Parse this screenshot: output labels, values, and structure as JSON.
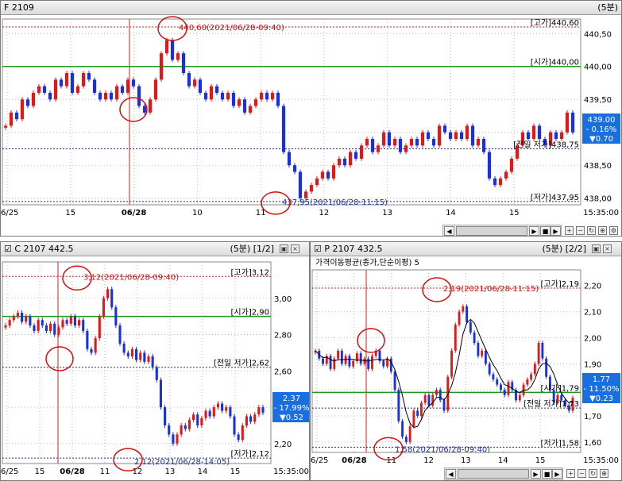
{
  "panels": {
    "top": {
      "title": "F 2109",
      "interval": "(5분)",
      "current_box": {
        "price": "439.00",
        "pct": "- 0.16%",
        "chg": "▼0.70"
      },
      "time_label": "15:35:00"
    },
    "left": {
      "title": "C 2107 442.5",
      "interval": "(5분)",
      "page": "[1/2]",
      "current_box": {
        "price": "2.37",
        "pct": "- 17.99%",
        "chg": "▼0.52"
      },
      "time_label": "15:35:00"
    },
    "right": {
      "title": "P 2107 432.5",
      "interval": "(5분)",
      "page": "[2/2]",
      "indicator": "가격이동평균(종가,단순이평) 5",
      "current_box": {
        "price": "1.77",
        "pct": "- 11.50%",
        "chg": "▼0.23"
      },
      "time_label": "15:35:00"
    }
  },
  "chart_data": [
    {
      "type": "candlestick",
      "title": "F 2109",
      "ylim": [
        437.9,
        440.72
      ],
      "yticks": [
        "440,50",
        "440,00",
        "439,50",
        "439,00",
        "438,50",
        "438,00"
      ],
      "ytick_values": [
        440.5,
        440.0,
        439.5,
        439.0,
        438.5,
        438.0
      ],
      "xticks": [
        "06/25",
        "15",
        "06/28",
        "10",
        "11",
        "12",
        "13",
        "14",
        "15"
      ],
      "annotations": {
        "high": {
          "label": "[고가]440,60",
          "value": 440.6,
          "note": "440,60(2021/06/28-09:40)"
        },
        "open": {
          "label": "[시가]440,00",
          "value": 440.0
        },
        "prev_low": {
          "label": "[전일 저가]438,75",
          "value": 438.75
        },
        "low": {
          "label": "[저가]437,95",
          "value": 437.95,
          "note": "437,95(2021/06/28-11:15)"
        }
      },
      "closes": [
        439.1,
        439.3,
        439.2,
        439.5,
        439.4,
        439.6,
        439.7,
        439.6,
        439.5,
        439.8,
        439.7,
        439.9,
        439.6,
        439.7,
        439.9,
        439.8,
        439.6,
        439.5,
        439.6,
        439.5,
        439.7,
        439.6,
        439.8,
        439.7,
        439.4,
        439.3,
        439.5,
        439.8,
        440.2,
        440.4,
        440.1,
        440.2,
        439.9,
        439.7,
        439.8,
        439.6,
        439.5,
        439.7,
        439.6,
        439.5,
        439.6,
        439.4,
        439.5,
        439.3,
        439.4,
        439.5,
        439.6,
        439.5,
        439.6,
        439.4,
        438.7,
        438.5,
        438.4,
        438.0,
        438.1,
        438.2,
        438.3,
        438.4,
        438.3,
        438.5,
        438.6,
        438.5,
        438.7,
        438.6,
        438.8,
        438.9,
        438.7,
        438.8,
        439.0,
        438.8,
        438.9,
        438.7,
        438.8,
        438.9,
        438.8,
        439.0,
        438.9,
        438.8,
        439.1,
        439.0,
        438.9,
        439.0,
        438.9,
        439.1,
        438.8,
        438.9,
        438.7,
        438.3,
        438.2,
        438.3,
        438.4,
        438.6,
        438.8,
        439.0,
        438.9,
        439.1,
        438.9,
        438.8,
        439.0,
        438.9,
        439.0,
        439.3,
        439.0
      ]
    },
    {
      "type": "candlestick",
      "title": "C 2107 442.5",
      "ylim": [
        2.09,
        3.2
      ],
      "yticks": [
        "3,00",
        "2,80",
        "2,60",
        "2,40",
        "2,20"
      ],
      "ytick_values": [
        3.0,
        2.8,
        2.6,
        2.4,
        2.2
      ],
      "xticks": [
        "06/25",
        "15",
        "06/28",
        "11",
        "12",
        "13",
        "14",
        "15"
      ],
      "annotations": {
        "high": {
          "label": "[고가]3,12",
          "value": 3.12,
          "note": "3,12(2021/06/28-09:40)"
        },
        "open": {
          "label": "[시가]2,90",
          "value": 2.9
        },
        "prev_low": {
          "label": "[전일 저가]2,62",
          "value": 2.62
        },
        "low": {
          "label": "[저가]2,12",
          "value": 2.12,
          "note": "2,12(2021/06/28-14:05)"
        }
      },
      "closes": [
        2.85,
        2.88,
        2.9,
        2.92,
        2.87,
        2.9,
        2.85,
        2.82,
        2.88,
        2.85,
        2.82,
        2.86,
        2.8,
        2.84,
        2.88,
        2.86,
        2.9,
        2.85,
        2.88,
        2.82,
        2.72,
        2.7,
        2.78,
        2.9,
        3.0,
        3.05,
        2.95,
        2.85,
        2.75,
        2.7,
        2.68,
        2.72,
        2.66,
        2.7,
        2.65,
        2.68,
        2.62,
        2.55,
        2.4,
        2.3,
        2.25,
        2.2,
        2.25,
        2.3,
        2.28,
        2.33,
        2.36,
        2.3,
        2.34,
        2.38,
        2.35,
        2.4,
        2.42,
        2.38,
        2.4,
        2.35,
        2.25,
        2.22,
        2.3,
        2.35,
        2.32,
        2.36,
        2.4,
        2.37
      ]
    },
    {
      "type": "candlestick",
      "title": "P 2107 432.5",
      "ylim": [
        1.56,
        2.26
      ],
      "yticks": [
        "2,20",
        "2,10",
        "2,00",
        "1,90",
        "1,80",
        "1,70",
        "1,60"
      ],
      "ytick_values": [
        2.2,
        2.1,
        2.0,
        1.9,
        1.8,
        1.7,
        1.6
      ],
      "xticks": [
        "06/25",
        "06/28",
        "11",
        "12",
        "13",
        "14",
        "15"
      ],
      "annotations": {
        "high": {
          "label": "[고가]2,19",
          "value": 2.19,
          "note": "2,19(2021/06/28-11:15)"
        },
        "open": {
          "label": "[시가]1,79",
          "value": 1.79
        },
        "prev_low": {
          "label": "[전일 저가]1,73",
          "value": 1.73
        },
        "low": {
          "label": "[저가]1,58",
          "value": 1.58,
          "note": "1,58(2021/06/28-09:40)"
        }
      },
      "closes": [
        1.95,
        1.92,
        1.9,
        1.93,
        1.88,
        1.92,
        1.95,
        1.9,
        1.93,
        1.89,
        1.91,
        1.94,
        1.9,
        1.92,
        1.88,
        1.93,
        1.95,
        1.91,
        1.89,
        1.92,
        1.87,
        1.8,
        1.68,
        1.62,
        1.6,
        1.66,
        1.72,
        1.7,
        1.75,
        1.78,
        1.74,
        1.78,
        1.8,
        1.76,
        1.72,
        1.85,
        1.95,
        2.05,
        2.1,
        2.12,
        2.06,
        2.02,
        1.98,
        1.93,
        1.95,
        1.9,
        1.86,
        1.84,
        1.82,
        1.8,
        1.78,
        1.83,
        1.8,
        1.76,
        1.78,
        1.82,
        1.84,
        1.86,
        1.9,
        1.98,
        1.92,
        1.85,
        1.8,
        1.75,
        1.78,
        1.76,
        1.74,
        1.72,
        1.77
      ]
    }
  ]
}
